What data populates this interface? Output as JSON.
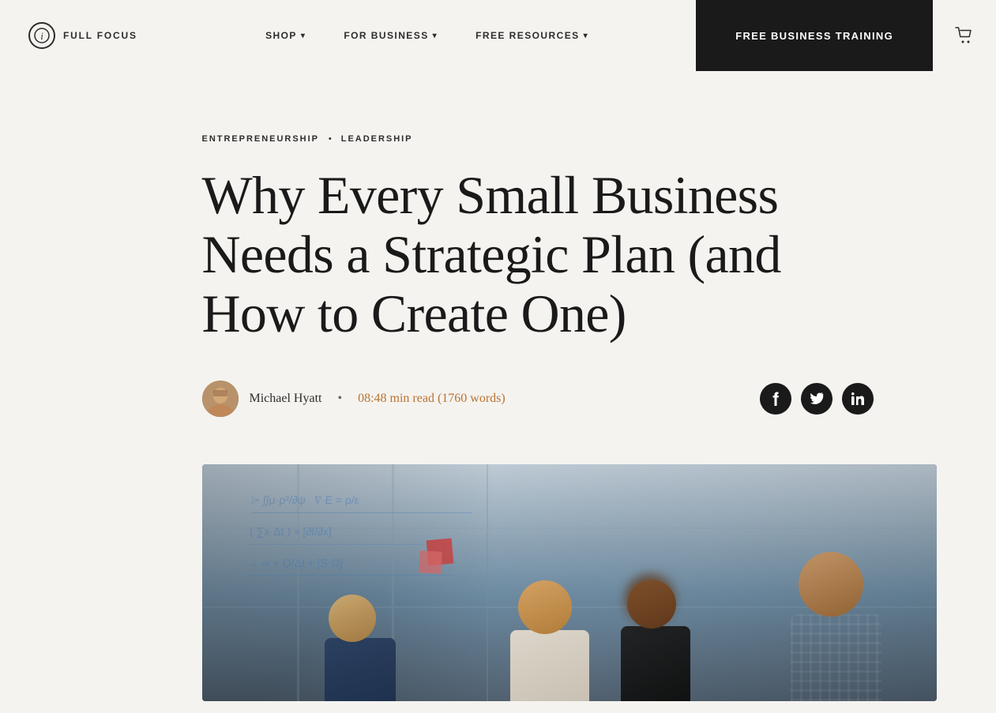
{
  "header": {
    "logo_icon": "i",
    "logo_text": "FULL FOCUS",
    "nav": {
      "shop_label": "SHOP",
      "for_business_label": "FOR BUSINESS",
      "free_resources_label": "FREE RESOURCES"
    },
    "cta_label": "FREE BUSINESS TRAINING",
    "cart_label": "Cart"
  },
  "article": {
    "category1": "ENTREPRENEURSHIP",
    "separator": "•",
    "category2": "LEADERSHIP",
    "title": "Why Every Small Business Needs a Strategic Plan (and How to Create One)",
    "author_name": "Michael Hyatt",
    "author_dot": "•",
    "read_time": "08:48 min read (1760 words)",
    "social": {
      "facebook_label": "Share on Facebook",
      "twitter_label": "Share on Twitter",
      "linkedin_label": "Share on LinkedIn"
    },
    "image_alt": "Business team collaborating at a glass whiteboard"
  },
  "colors": {
    "background": "#f5f3ef",
    "text_dark": "#1a1a1a",
    "cta_bg": "#1a1a1a",
    "cta_text": "#ffffff",
    "read_time_color": "#b87333",
    "social_bg": "#1a1a1a"
  }
}
